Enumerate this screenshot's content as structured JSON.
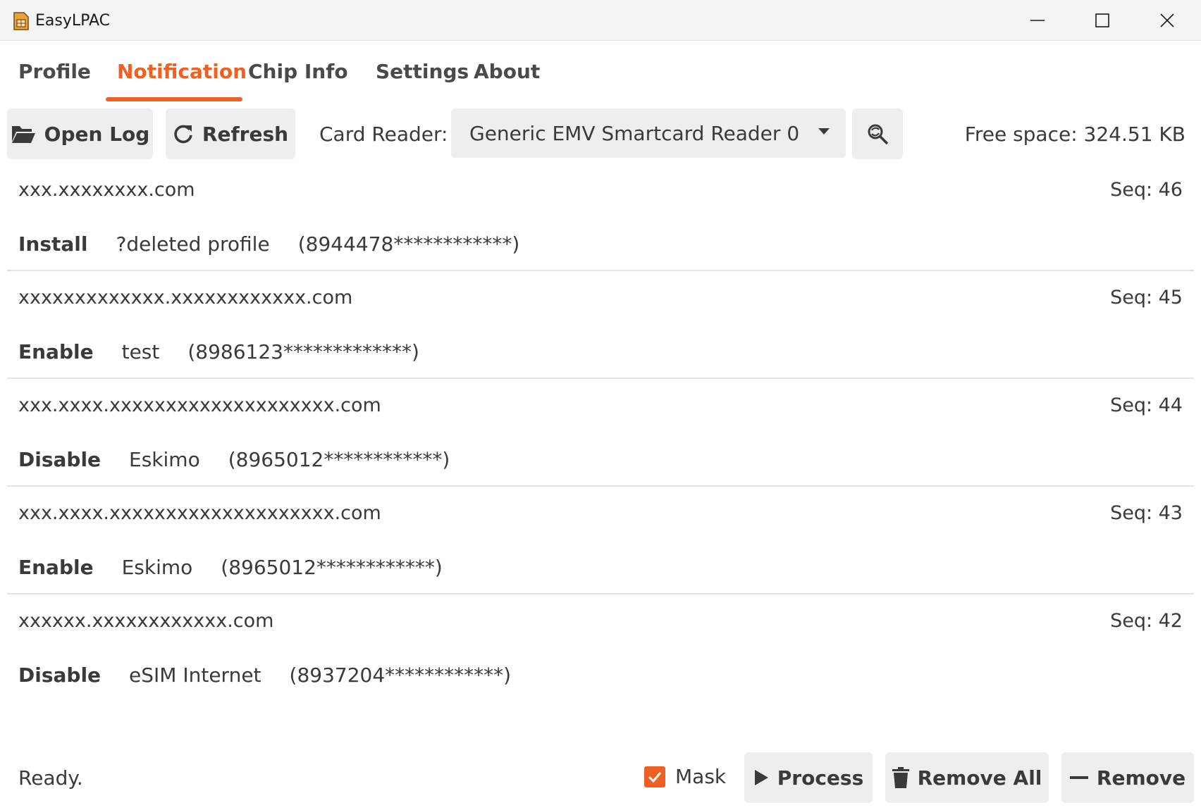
{
  "window": {
    "title": "EasyLPAC",
    "app_icon": "sim-card-icon",
    "controls": [
      "minimize-icon",
      "maximize-icon",
      "close-icon"
    ]
  },
  "tabs": [
    {
      "label": "Profile",
      "active": false
    },
    {
      "label": "Notification",
      "active": true
    },
    {
      "label": "Chip Info",
      "active": false
    },
    {
      "label": "Settings",
      "active": false
    },
    {
      "label": "About",
      "active": false
    }
  ],
  "toolbar": {
    "open_log_label": "Open Log",
    "open_log_icon": "folder-open-icon",
    "refresh_label": "Refresh",
    "refresh_icon": "refresh-icon",
    "card_reader_label": "Card Reader:",
    "card_reader_value": "Generic EMV Smartcard Reader 0",
    "scan_reader_icon": "search-refresh-icon",
    "free_space": "Free space: 324.51 KB"
  },
  "notifications": [
    {
      "host": "xxx.xxxxxxxx.com",
      "seq": "Seq: 46",
      "action": "Install",
      "profile": "?deleted profile",
      "iccid": "(8944478************)"
    },
    {
      "host": "xxxxxxxxxxxxx.xxxxxxxxxxxx.com",
      "seq": "Seq: 45",
      "action": "Enable",
      "profile": "test",
      "iccid": "(8986123*************)"
    },
    {
      "host": "xxx.xxxx.xxxxxxxxxxxxxxxxxxxx.com",
      "seq": "Seq: 44",
      "action": "Disable",
      "profile": "Eskimo",
      "iccid": "(8965012************)"
    },
    {
      "host": "xxx.xxxx.xxxxxxxxxxxxxxxxxxxx.com",
      "seq": "Seq: 43",
      "action": "Enable",
      "profile": "Eskimo",
      "iccid": "(8965012************)"
    },
    {
      "host": "xxxxxx.xxxxxxxxxxxx.com",
      "seq": "Seq: 42",
      "action": "Disable",
      "profile": "eSIM Internet",
      "iccid": "(8937204************)"
    }
  ],
  "footer": {
    "status": "Ready.",
    "mask_label": "Mask",
    "mask_checked": true,
    "process_label": "Process",
    "remove_all_label": "Remove All",
    "remove_label": "Remove"
  },
  "colors": {
    "accent": "#f06022",
    "button_bg": "#eeeeee",
    "titlebar_bg": "#f3f3f3"
  }
}
